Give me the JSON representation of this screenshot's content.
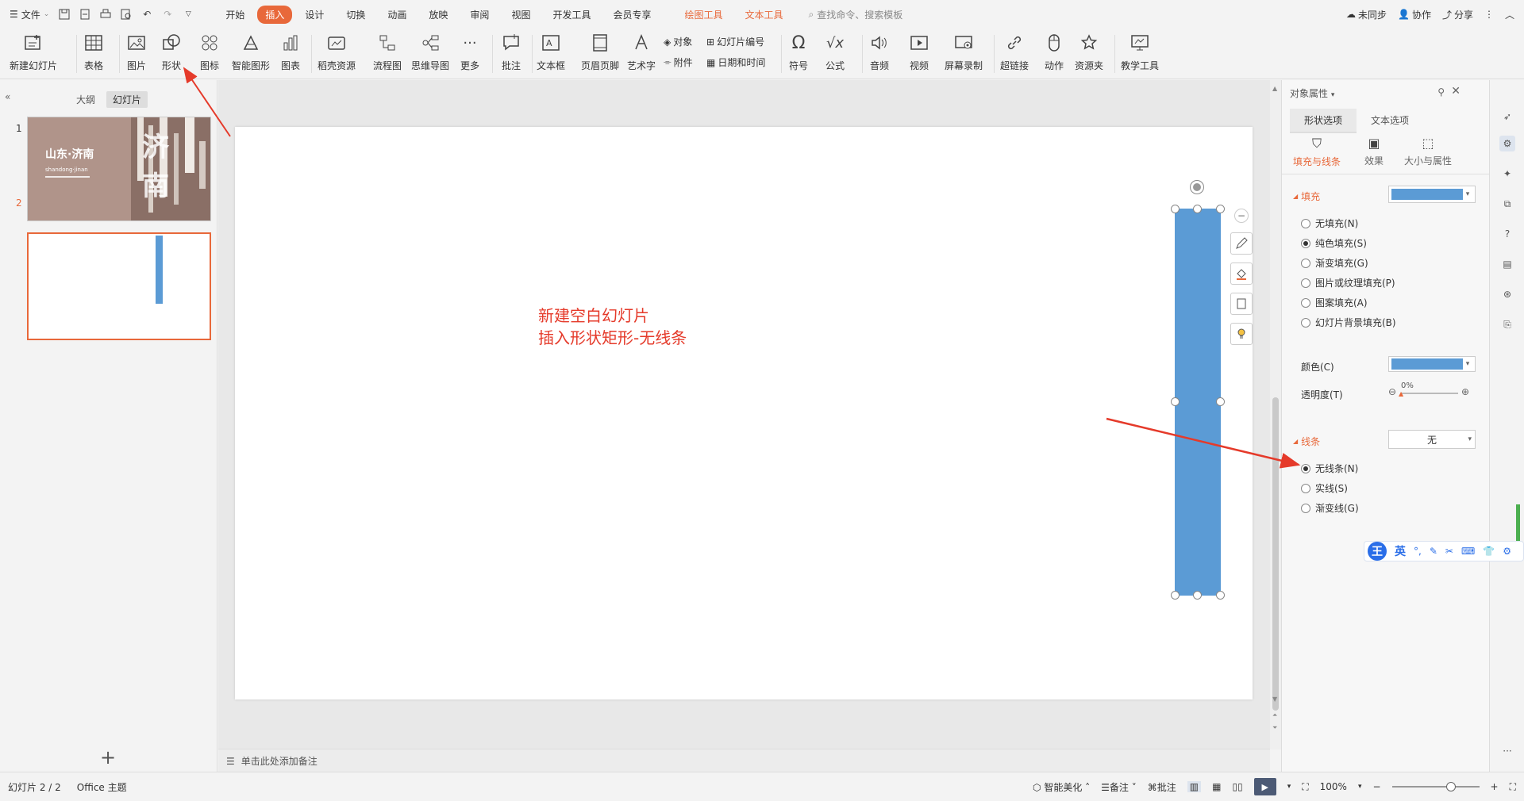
{
  "titlebar": {
    "file_menu": "文件",
    "tabs": [
      {
        "label": "开始",
        "active": false,
        "contextual": false
      },
      {
        "label": "插入",
        "active": true,
        "contextual": false
      },
      {
        "label": "设计",
        "active": false,
        "contextual": false
      },
      {
        "label": "切换",
        "active": false,
        "contextual": false
      },
      {
        "label": "动画",
        "active": false,
        "contextual": false
      },
      {
        "label": "放映",
        "active": false,
        "contextual": false
      },
      {
        "label": "审阅",
        "active": false,
        "contextual": false
      },
      {
        "label": "视图",
        "active": false,
        "contextual": false
      },
      {
        "label": "开发工具",
        "active": false,
        "contextual": false
      },
      {
        "label": "会员专享",
        "active": false,
        "contextual": false
      },
      {
        "label": "绘图工具",
        "active": false,
        "contextual": true
      },
      {
        "label": "文本工具",
        "active": false,
        "contextual": true
      }
    ],
    "search_placeholder": "查找命令、搜索模板",
    "sync": "未同步",
    "collab": "协作",
    "share": "分享"
  },
  "ribbon": {
    "new_slide": "新建幻灯片",
    "table": "表格",
    "picture": "图片",
    "shape": "形状",
    "icon": "图标",
    "smartart": "智能图形",
    "chart": "图表",
    "resources": "稻壳资源",
    "flowchart": "流程图",
    "mindmap": "思维导图",
    "more": "更多",
    "comment": "批注",
    "textbox": "文本框",
    "header_footer": "页眉页脚",
    "wordart": "艺术字",
    "object": "对象",
    "slide_number": "幻灯片编号",
    "attachment": "附件",
    "datetime": "日期和时间",
    "symbol": "符号",
    "formula": "公式",
    "audio": "音频",
    "video": "视频",
    "screen_record": "屏幕录制",
    "hyperlink": "超链接",
    "action": "动作",
    "resource_folder": "资源夹",
    "teaching_tools": "教学工具"
  },
  "left_pane": {
    "tab_outline": "大纲",
    "tab_slides": "幻灯片",
    "slide1_num": "1",
    "slide2_num": "2",
    "slide1_title": "山东·济南",
    "slide1_sub": "shandong·jinan",
    "slide1_deco": "济南"
  },
  "slide": {
    "annotation_line1": "新建空白幻灯片",
    "annotation_line2": "插入形状矩形-无线条",
    "notes_placeholder": "单击此处添加备注"
  },
  "right_pane": {
    "title": "对象属性",
    "tab_shape": "形状选项",
    "tab_text": "文本选项",
    "sub_fill_line": "填充与线条",
    "sub_effects": "效果",
    "sub_size": "大小与属性",
    "fill_section": "填充",
    "fill_options": [
      {
        "label": "无填充(N)",
        "checked": false
      },
      {
        "label": "纯色填充(S)",
        "checked": true
      },
      {
        "label": "渐变填充(G)",
        "checked": false
      },
      {
        "label": "图片或纹理填充(P)",
        "checked": false
      },
      {
        "label": "图案填充(A)",
        "checked": false
      },
      {
        "label": "幻灯片背景填充(B)",
        "checked": false
      }
    ],
    "color_label": "颜色(C)",
    "transparency_label": "透明度(T)",
    "transparency_value": "0%",
    "line_section": "线条",
    "line_value": "无",
    "line_options": [
      {
        "label": "无线条(N)",
        "checked": true
      },
      {
        "label": "实线(S)",
        "checked": false
      },
      {
        "label": "渐变线(G)",
        "checked": false
      }
    ],
    "fill_color": "#5b9bd5"
  },
  "ime": {
    "logo": "王",
    "mode": "英"
  },
  "status": {
    "slide_count": "幻灯片 2 / 2",
    "theme": "Office 主题",
    "beautify": "智能美化",
    "notes": "备注",
    "comment": "批注",
    "zoom": "100%"
  },
  "colors": {
    "accent": "#e8683a",
    "shape_fill": "#5b9bd5",
    "annotation": "#e53a2a"
  }
}
